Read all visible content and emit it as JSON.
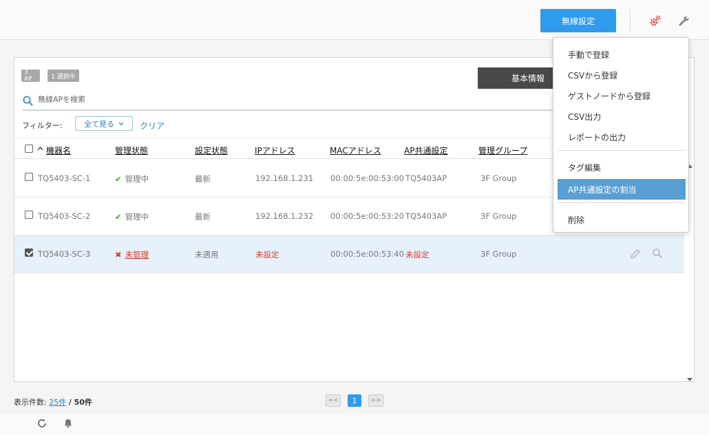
{
  "header": {
    "wireless_settings_label": "無線設定",
    "icons": [
      "gears-icon",
      "wrench-icon"
    ]
  },
  "panel": {
    "badges": {
      "ap_count": "3 AP",
      "selected": "1 選択中"
    },
    "basic_info_label": "基本情報",
    "search": {
      "placeholder": "無線APを検索"
    },
    "filter": {
      "label": "フィルター:",
      "select_value": "全て見る",
      "clear_label": "クリア"
    },
    "columns": {
      "name": "機器名",
      "admin_status": "管理状態",
      "config_status": "設定状態",
      "ip": "IPアドレス",
      "mac": "MACアドレス",
      "ap_common": "AP共通設定",
      "group": "管理グループ"
    },
    "rows": [
      {
        "name": "TQ5403-SC-1",
        "admin_status": "管理中",
        "config_status": "最新",
        "ip": "192.168.1.231",
        "mac": "00:00:5e:00:53:00",
        "ap_common": "TQ5403AP",
        "group": "3F Group",
        "checked": false
      },
      {
        "name": "TQ5403-SC-2",
        "admin_status": "管理中",
        "config_status": "最新",
        "ip": "192.168.1.232",
        "mac": "00:00:5e:00:53:20",
        "ap_common": "TQ5403AP",
        "group": "3F Group",
        "checked": false
      },
      {
        "name": "TQ5403-SC-3",
        "admin_status": "未管理",
        "config_status": "未適用",
        "ip": "未設定",
        "mac": "00:00:5e:00:53:40",
        "ap_common": "未設定",
        "group": "3F Group",
        "checked": true
      }
    ]
  },
  "menu": {
    "items": [
      "手動で登録",
      "CSVから登録",
      "ゲストノードから登録",
      "CSV出力",
      "レポートの出力",
      "タグ編集",
      "AP共通設定の割当",
      "削除"
    ],
    "highlighted": "AP共通設定の割当"
  },
  "footer": {
    "count_label": "表示件数:",
    "per_page": "25件",
    "total": "/ 50件",
    "prev": "<<",
    "page": "1",
    "next": ">>"
  },
  "colors": {
    "primary": "#2f9bef",
    "ok": "#3aa637",
    "error": "#e03c31",
    "highlight": "#5a9fd4",
    "dark_tab": "#4a4847"
  }
}
